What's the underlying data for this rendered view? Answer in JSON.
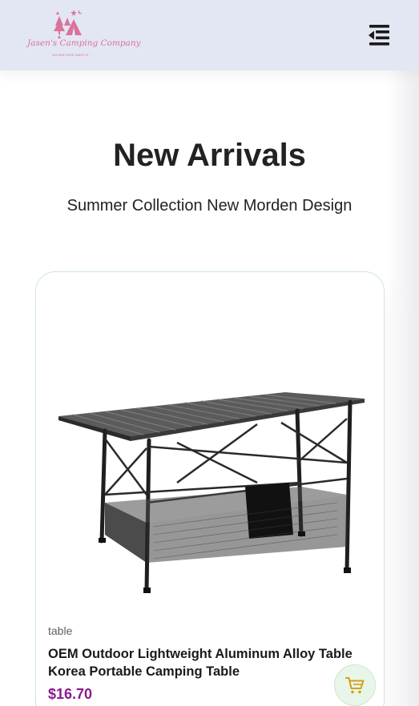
{
  "header": {
    "logo_text": "Jasen's Camping Company",
    "logo_subtext": "ADVENTURE AWAITS",
    "menu_icon": "menu-collapse-icon"
  },
  "hero": {
    "title": "New Arrivals",
    "subtitle": "Summer Collection New Morden Design"
  },
  "products": [
    {
      "image": "folding-camping-table",
      "brand": "table",
      "name": "OEM Outdoor Lightweight Aluminum Alloy Table Korea Portable Camping Table",
      "price": "$16.70",
      "cart_icon": "cart-icon"
    }
  ],
  "colors": {
    "header_bg": "#e3e6f3",
    "logo_pink": "#d9739a",
    "price": "#8b1a8b",
    "card_border": "#cce7d0",
    "cart_bg": "#e8f6ea",
    "cart_icon": "#d4a017"
  }
}
